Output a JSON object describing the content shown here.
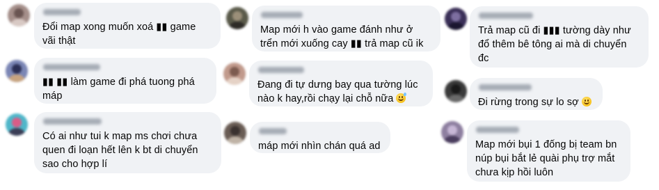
{
  "colors": {
    "bubble": "#f0f2f5",
    "text": "#050505",
    "blurred_name": "#9aa1ab"
  },
  "comments": [
    {
      "name": "blurred-name",
      "text": "Đổi map xong muốn xoá ▮▮ game\nvãi thật",
      "avatar_colors": [
        "#a58f8a",
        "#6a5552",
        "#d8c9c4"
      ]
    },
    {
      "name": "blurred-name",
      "text": "▮▮ ▮▮ làm game đi phá tuong phá\nmáp",
      "avatar_colors": [
        "#7b86b5",
        "#2b2f55",
        "#c7a37f"
      ]
    },
    {
      "name": "blurred-name",
      "text": "Có ai như tui k map ms chơi chưa\nquen đi loạn hết lên k bt di chuyển\nsao cho hợp lí",
      "avatar_colors": [
        "#4fb6c9",
        "#d85c87",
        "#3b3d56"
      ]
    },
    {
      "name": "blurred-name",
      "text": "Map mới h vào game đánh như ở\ntrển mới xuống cay ▮▮ trả map cũ ik",
      "avatar_colors": [
        "#5a5a4a",
        "#9b8f79",
        "#2e2b27"
      ]
    },
    {
      "name": "blurred-name",
      "text": "Đang đi tự dưng bay qua tường lúc\nnào k hay,rồi chạy lại chỗ nữa",
      "emoji": "sweat-smile",
      "avatar_colors": [
        "#c19a8c",
        "#7c5b4f",
        "#e5d2c6"
      ]
    },
    {
      "name": "blurred-name",
      "text": "máp mới nhìn chán quá ad",
      "avatar_colors": [
        "#6a5d55",
        "#3a3230",
        "#bfb3a6"
      ]
    },
    {
      "name": "blurred-name",
      "text": "Trả map cũ đi ▮▮▮ tường dày như\nđổ thêm bê tông ai mà di chuyển\nđc",
      "avatar_colors": [
        "#3a2f57",
        "#7d6fa0",
        "#1b1630"
      ]
    },
    {
      "name": "blurred-name",
      "text": "Đi rừng trong sự lo sợ",
      "emoji": "smile",
      "avatar_colors": [
        "#3a3a3a",
        "#1a1a1a",
        "#6a6a6a"
      ]
    },
    {
      "name": "blurred-name",
      "text": "Map mới bụi 1 đống bị team bn\nnúp bụi bắt lẻ quài phụ trợ mắt\nchưa kịp hồi luôn",
      "avatar_colors": [
        "#8e7fa0",
        "#c7b7d6",
        "#4a3d5e"
      ]
    }
  ]
}
